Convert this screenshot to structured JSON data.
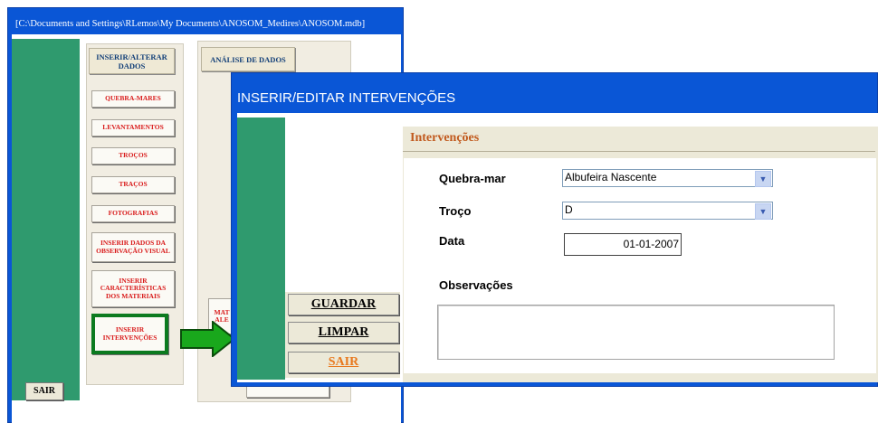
{
  "back_window": {
    "title": "[C:\\Documents and Settings\\RLemos\\My Documents\\ANOSOM_Medires\\ANOSOM.mdb]",
    "sair_label": "SAIR",
    "left_panel": {
      "header": "INSERIR/ALTERAR DADOS",
      "buttons": [
        "QUEBRA-MARES",
        "LEVANTAMENTOS",
        "TROÇOS",
        "TRAÇOS",
        "FOTOGRAFIAS",
        "INSERIR DADOS DA OBSERVAÇÃO VISUAL",
        "INSERIR CARACTERÍSTICAS DOS MATERIAIS",
        "INSERIR INTERVENÇÕES"
      ]
    },
    "right_panel": {
      "header": "ANÁLISE DE DADOS",
      "partial_button": "MAT ALE"
    }
  },
  "colors": {
    "window_blue": "#0a56d6",
    "green_strip": "#2f9a6e",
    "highlight_green": "#0c7a1f",
    "button_text_red": "#d91c1c",
    "section_orange": "#c15a1e"
  },
  "dialog": {
    "title": "INSERIR/EDITAR INTERVENÇÕES",
    "section_title": "Intervenções",
    "buttons": {
      "guardar": "GUARDAR",
      "limpar": "LIMPAR",
      "sair": "SAIR"
    },
    "fields": {
      "quebra_mar_label": "Quebra-mar",
      "quebra_mar_value": "Albufeira Nascente",
      "troco_label": "Troço",
      "troco_value": "D",
      "data_label": "Data",
      "data_value": "01-01-2007",
      "observacoes_label": "Observações",
      "observacoes_value": ""
    }
  }
}
